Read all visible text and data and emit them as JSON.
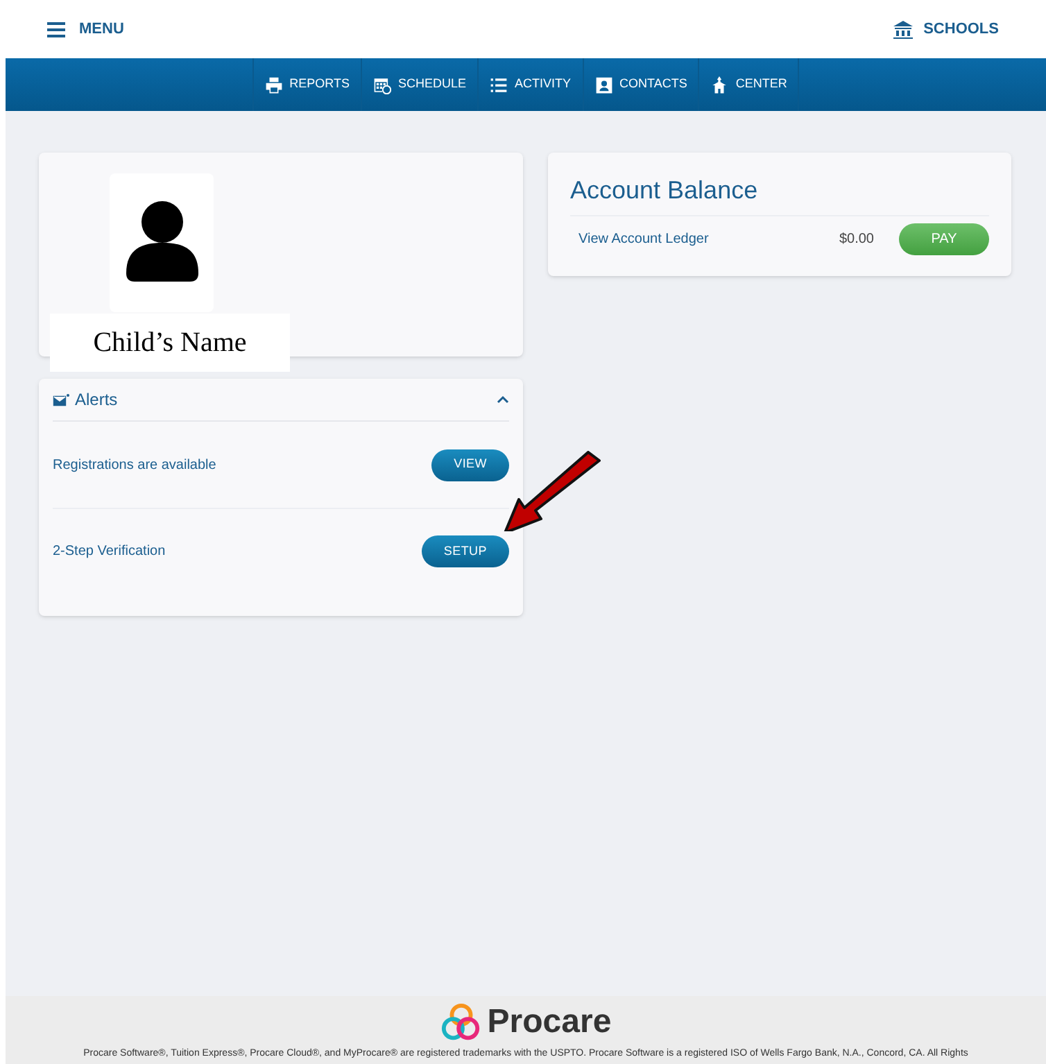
{
  "header": {
    "menu": "MENU",
    "schools": "SCHOOLS"
  },
  "nav": [
    {
      "label": "REPORTS",
      "kind": "printer"
    },
    {
      "label": "SCHEDULE",
      "kind": "calendar"
    },
    {
      "label": "ACTIVITY",
      "kind": "list"
    },
    {
      "label": "CONTACTS",
      "kind": "contact"
    },
    {
      "label": "CENTER",
      "kind": "building"
    }
  ],
  "profile": {
    "name": "Child’s Name"
  },
  "alerts": {
    "title": "Alerts",
    "expanded": true,
    "items": [
      {
        "text": "Registrations are available",
        "button": "VIEW"
      },
      {
        "text": "2-Step Verification",
        "button": "SETUP"
      }
    ]
  },
  "account": {
    "title": "Account Balance",
    "link": "View Account Ledger",
    "amount": "$0.00",
    "button": "PAY"
  },
  "footer": {
    "brand": "Procare",
    "legal": "Procare Software®, Tuition Express®, Procare Cloud®, and MyProcare® are registered trademarks with the USPTO. Procare Software is a registered ISO of Wells Fargo Bank, N.A., Concord, CA. All Rights"
  }
}
